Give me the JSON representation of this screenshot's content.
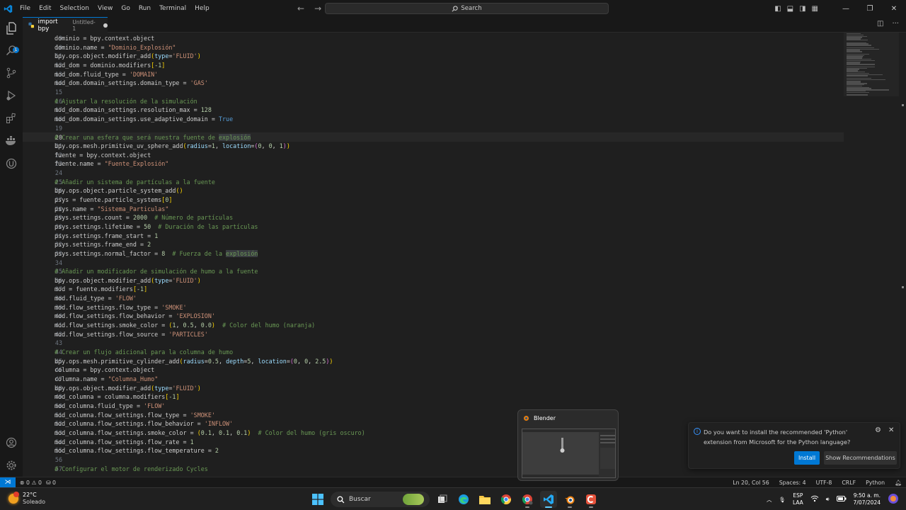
{
  "menu": [
    "File",
    "Edit",
    "Selection",
    "View",
    "Go",
    "Run",
    "Terminal",
    "Help"
  ],
  "command_center": {
    "placeholder": "Search"
  },
  "tab": {
    "title": "import bpy",
    "description": "Untitled-1"
  },
  "activity": {
    "explorer_badge": "1"
  },
  "code_lines": [
    {
      "n": "9",
      "tokens": [
        [
          "dominio = bpy.context.object",
          ""
        ]
      ]
    },
    {
      "n": "10",
      "tokens": [
        [
          "dominio.name = ",
          ""
        ],
        [
          "\"Dominio_Explosión\"",
          "s"
        ]
      ]
    },
    {
      "n": "11",
      "tokens": [
        [
          "bpy.ops.object.modifier_add",
          ""
        ],
        [
          "(",
          "b1"
        ],
        [
          "type",
          "p"
        ],
        [
          "=",
          ""
        ],
        [
          "'FLUID'",
          "s"
        ],
        [
          ")",
          "b1"
        ]
      ]
    },
    {
      "n": "12",
      "tokens": [
        [
          "mod_dom = dominio.modifiers",
          ""
        ],
        [
          "[",
          "b1"
        ],
        [
          "-1",
          "n"
        ],
        [
          "]",
          "b1"
        ]
      ]
    },
    {
      "n": "13",
      "tokens": [
        [
          "mod_dom.fluid_type = ",
          ""
        ],
        [
          "'DOMAIN'",
          "s"
        ]
      ]
    },
    {
      "n": "14",
      "tokens": [
        [
          "mod_dom.domain_settings.domain_type = ",
          ""
        ],
        [
          "'GAS'",
          "s"
        ]
      ]
    },
    {
      "n": "15",
      "tokens": []
    },
    {
      "n": "16",
      "tokens": [
        [
          "# Ajustar la resolución de la simulación",
          "c"
        ]
      ]
    },
    {
      "n": "17",
      "tokens": [
        [
          "mod_dom.domain_settings.resolution_max = ",
          ""
        ],
        [
          "128",
          "n"
        ]
      ]
    },
    {
      "n": "18",
      "tokens": [
        [
          "mod_dom.domain_settings.use_adaptive_domain = ",
          ""
        ],
        [
          "True",
          "k"
        ]
      ]
    },
    {
      "n": "19",
      "tokens": []
    },
    {
      "n": "20",
      "tokens": [
        [
          "# Crear una esfera que será nuestra fuente de ",
          "c"
        ],
        [
          "explosión",
          "c hl"
        ]
      ]
    },
    {
      "n": "21",
      "tokens": [
        [
          "bpy.ops.mesh.primitive_uv_sphere_add",
          ""
        ],
        [
          "(",
          "b1"
        ],
        [
          "radius",
          "p"
        ],
        [
          "=",
          ""
        ],
        [
          "1",
          "n"
        ],
        [
          ", ",
          ""
        ],
        [
          "location",
          "p"
        ],
        [
          "=",
          ""
        ],
        [
          "(",
          "b2"
        ],
        [
          "0",
          "n"
        ],
        [
          ", ",
          ""
        ],
        [
          "0",
          "n"
        ],
        [
          ", ",
          ""
        ],
        [
          "1",
          "n"
        ],
        [
          ")",
          "b2"
        ],
        [
          ")",
          "b1"
        ]
      ]
    },
    {
      "n": "22",
      "tokens": [
        [
          "fuente = bpy.context.object",
          ""
        ]
      ]
    },
    {
      "n": "23",
      "tokens": [
        [
          "fuente.name = ",
          ""
        ],
        [
          "\"Fuente_Explosión\"",
          "s"
        ]
      ]
    },
    {
      "n": "24",
      "tokens": []
    },
    {
      "n": "25",
      "tokens": [
        [
          "# Añadir un sistema de partículas a la fuente",
          "c"
        ]
      ]
    },
    {
      "n": "26",
      "tokens": [
        [
          "bpy.ops.object.particle_system_add",
          ""
        ],
        [
          "()",
          "b1"
        ]
      ]
    },
    {
      "n": "27",
      "tokens": [
        [
          "psys = fuente.particle_systems",
          ""
        ],
        [
          "[",
          "b1"
        ],
        [
          "0",
          "n"
        ],
        [
          "]",
          "b1"
        ]
      ]
    },
    {
      "n": "28",
      "tokens": [
        [
          "psys.name = ",
          ""
        ],
        [
          "\"Sistema_Particulas\"",
          "s"
        ]
      ]
    },
    {
      "n": "29",
      "tokens": [
        [
          "psys.settings.count = ",
          ""
        ],
        [
          "2000",
          "n"
        ],
        [
          "  ",
          ""
        ],
        [
          "# Número de partículas",
          "c"
        ]
      ]
    },
    {
      "n": "30",
      "tokens": [
        [
          "psys.settings.lifetime = ",
          ""
        ],
        [
          "50",
          "n"
        ],
        [
          "  ",
          ""
        ],
        [
          "# Duración de las partículas",
          "c"
        ]
      ]
    },
    {
      "n": "31",
      "tokens": [
        [
          "psys.settings.frame_start = ",
          ""
        ],
        [
          "1",
          "n"
        ]
      ]
    },
    {
      "n": "32",
      "tokens": [
        [
          "psys.settings.frame_end = ",
          ""
        ],
        [
          "2",
          "n"
        ]
      ]
    },
    {
      "n": "33",
      "tokens": [
        [
          "psys.settings.normal_factor = ",
          ""
        ],
        [
          "8",
          "n"
        ],
        [
          "  ",
          ""
        ],
        [
          "# Fuerza de la ",
          "c"
        ],
        [
          "explosión",
          "c hl"
        ]
      ]
    },
    {
      "n": "34",
      "tokens": []
    },
    {
      "n": "35",
      "tokens": [
        [
          "# Añadir un modificador de simulación de humo a la fuente",
          "c"
        ]
      ]
    },
    {
      "n": "36",
      "tokens": [
        [
          "bpy.ops.object.modifier_add",
          ""
        ],
        [
          "(",
          "b1"
        ],
        [
          "type",
          "p"
        ],
        [
          "=",
          ""
        ],
        [
          "'FLUID'",
          "s"
        ],
        [
          ")",
          "b1"
        ]
      ]
    },
    {
      "n": "37",
      "tokens": [
        [
          "mod = fuente.modifiers",
          ""
        ],
        [
          "[",
          "b1"
        ],
        [
          "-1",
          "n"
        ],
        [
          "]",
          "b1"
        ]
      ]
    },
    {
      "n": "38",
      "tokens": [
        [
          "mod.fluid_type = ",
          ""
        ],
        [
          "'FLOW'",
          "s"
        ]
      ]
    },
    {
      "n": "39",
      "tokens": [
        [
          "mod.flow_settings.flow_type = ",
          ""
        ],
        [
          "'SMOKE'",
          "s"
        ]
      ]
    },
    {
      "n": "40",
      "tokens": [
        [
          "mod.flow_settings.flow_behavior = ",
          ""
        ],
        [
          "'EXPLOSION'",
          "s"
        ]
      ]
    },
    {
      "n": "41",
      "tokens": [
        [
          "mod.flow_settings.smoke_color = ",
          ""
        ],
        [
          "(",
          "b1"
        ],
        [
          "1",
          "n"
        ],
        [
          ", ",
          ""
        ],
        [
          "0.5",
          "n"
        ],
        [
          ", ",
          ""
        ],
        [
          "0.0",
          "n"
        ],
        [
          ")",
          "b1"
        ],
        [
          "  ",
          ""
        ],
        [
          "# Color del humo (naranja)",
          "c"
        ]
      ]
    },
    {
      "n": "42",
      "tokens": [
        [
          "mod.flow_settings.flow_source = ",
          ""
        ],
        [
          "'PARTICLES'",
          "s"
        ]
      ]
    },
    {
      "n": "43",
      "tokens": []
    },
    {
      "n": "44",
      "tokens": [
        [
          "# Crear un flujo adicional para la columna de humo",
          "c"
        ]
      ]
    },
    {
      "n": "45",
      "tokens": [
        [
          "bpy.ops.mesh.primitive_cylinder_add",
          ""
        ],
        [
          "(",
          "b1"
        ],
        [
          "radius",
          "p"
        ],
        [
          "=",
          ""
        ],
        [
          "0.5",
          "n"
        ],
        [
          ", ",
          ""
        ],
        [
          "depth",
          "p"
        ],
        [
          "=",
          ""
        ],
        [
          "5",
          "n"
        ],
        [
          ", ",
          ""
        ],
        [
          "location",
          "p"
        ],
        [
          "=",
          ""
        ],
        [
          "(",
          "b2"
        ],
        [
          "0",
          "n"
        ],
        [
          ", ",
          ""
        ],
        [
          "0",
          "n"
        ],
        [
          ", ",
          ""
        ],
        [
          "2.5",
          "n"
        ],
        [
          ")",
          "b2"
        ],
        [
          ")",
          "b1"
        ]
      ]
    },
    {
      "n": "46",
      "tokens": [
        [
          "columna = bpy.context.object",
          ""
        ]
      ]
    },
    {
      "n": "47",
      "tokens": [
        [
          "columna.name = ",
          ""
        ],
        [
          "\"Columna_Humo\"",
          "s"
        ]
      ]
    },
    {
      "n": "48",
      "tokens": [
        [
          "bpy.ops.object.modifier_add",
          ""
        ],
        [
          "(",
          "b1"
        ],
        [
          "type",
          "p"
        ],
        [
          "=",
          ""
        ],
        [
          "'FLUID'",
          "s"
        ],
        [
          ")",
          "b1"
        ]
      ]
    },
    {
      "n": "49",
      "tokens": [
        [
          "mod_columna = columna.modifiers",
          ""
        ],
        [
          "[",
          "b1"
        ],
        [
          "-1",
          "n"
        ],
        [
          "]",
          "b1"
        ]
      ]
    },
    {
      "n": "50",
      "tokens": [
        [
          "mod_columna.fluid_type = ",
          ""
        ],
        [
          "'FLOW'",
          "s"
        ]
      ]
    },
    {
      "n": "51",
      "tokens": [
        [
          "mod_columna.flow_settings.flow_type = ",
          ""
        ],
        [
          "'SMOKE'",
          "s"
        ]
      ]
    },
    {
      "n": "52",
      "tokens": [
        [
          "mod_columna.flow_settings.flow_behavior = ",
          ""
        ],
        [
          "'INFLOW'",
          "s"
        ]
      ]
    },
    {
      "n": "53",
      "tokens": [
        [
          "mod_columna.flow_settings.smoke_color = ",
          ""
        ],
        [
          "(",
          "b1"
        ],
        [
          "0.1",
          "n"
        ],
        [
          ", ",
          ""
        ],
        [
          "0.1",
          "n"
        ],
        [
          ", ",
          ""
        ],
        [
          "0.1",
          "n"
        ],
        [
          ")",
          "b1"
        ],
        [
          "  ",
          ""
        ],
        [
          "# Color del humo (gris oscuro)",
          "c"
        ]
      ]
    },
    {
      "n": "54",
      "tokens": [
        [
          "mod_columna.flow_settings.flow_rate = ",
          ""
        ],
        [
          "1",
          "n"
        ]
      ]
    },
    {
      "n": "55",
      "tokens": [
        [
          "mod_columna.flow_settings.flow_temperature = ",
          ""
        ],
        [
          "2",
          "n"
        ]
      ]
    },
    {
      "n": "56",
      "tokens": []
    },
    {
      "n": "57",
      "tokens": [
        [
          "# Configurar el motor de renderizado Cycles",
          "c"
        ]
      ]
    }
  ],
  "current_line": "20",
  "statusbar": {
    "errors": "0",
    "warnings": "0",
    "ports": "0",
    "position": "Ln 20, Col 56",
    "spaces": "Spaces: 4",
    "encoding": "UTF-8",
    "eol": "CRLF",
    "language": "Python"
  },
  "notification": {
    "message": "Do you want to install the recommended 'Python' extension from Microsoft for the Python language?",
    "install_label": "Install",
    "show_label": "Show Recommendations"
  },
  "thumbnail": {
    "title": "Blender"
  },
  "taskbar": {
    "weather_temp": "22°C",
    "weather_desc": "Soleado",
    "search_placeholder": "Buscar",
    "lang_top": "ESP",
    "lang_bottom": "LAA",
    "time": "9:50 a. m.",
    "date": "7/07/2024"
  },
  "colors": {
    "accent": "#0078d4",
    "keyword": "#569cd6",
    "string": "#ce9178",
    "number": "#b5cea8",
    "comment": "#6a9955",
    "param": "#9cdcfe"
  }
}
